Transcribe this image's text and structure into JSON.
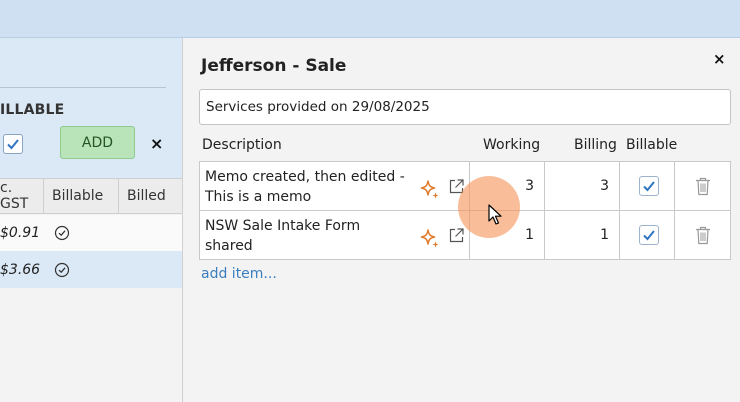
{
  "left_panel": {
    "billable_heading": "ILLABLE",
    "add_label": "ADD",
    "close_glyph": "×",
    "columns": [
      "c. GST",
      "Billable",
      "Billed"
    ],
    "rows": [
      {
        "amount": "$0.91",
        "billable_icon": "check-circle-icon"
      },
      {
        "amount": "$3.66",
        "billable_icon": "check-circle-icon"
      }
    ]
  },
  "panel": {
    "title": "Jefferson - Sale",
    "close_glyph": "×",
    "description_value": "Services provided on 29/08/2025",
    "headers": {
      "description": "Description",
      "working": "Working",
      "billing": "Billing",
      "billable": "Billable"
    },
    "items": [
      {
        "description": "Memo created, then edited - This is a memo",
        "working": "3",
        "billing": "3",
        "billable": true
      },
      {
        "description": "NSW Sale Intake Form shared",
        "working": "1",
        "billing": "1",
        "billable": true
      }
    ],
    "add_item_label": "add item..."
  },
  "colors": {
    "topbar": "#cfe0f3",
    "add_button": "#b9e4b9",
    "link": "#3a7dc0",
    "sparkle": "#e07a2c",
    "checkbox_tick": "#2f74c0",
    "cursor_highlight": "#f5965a"
  }
}
